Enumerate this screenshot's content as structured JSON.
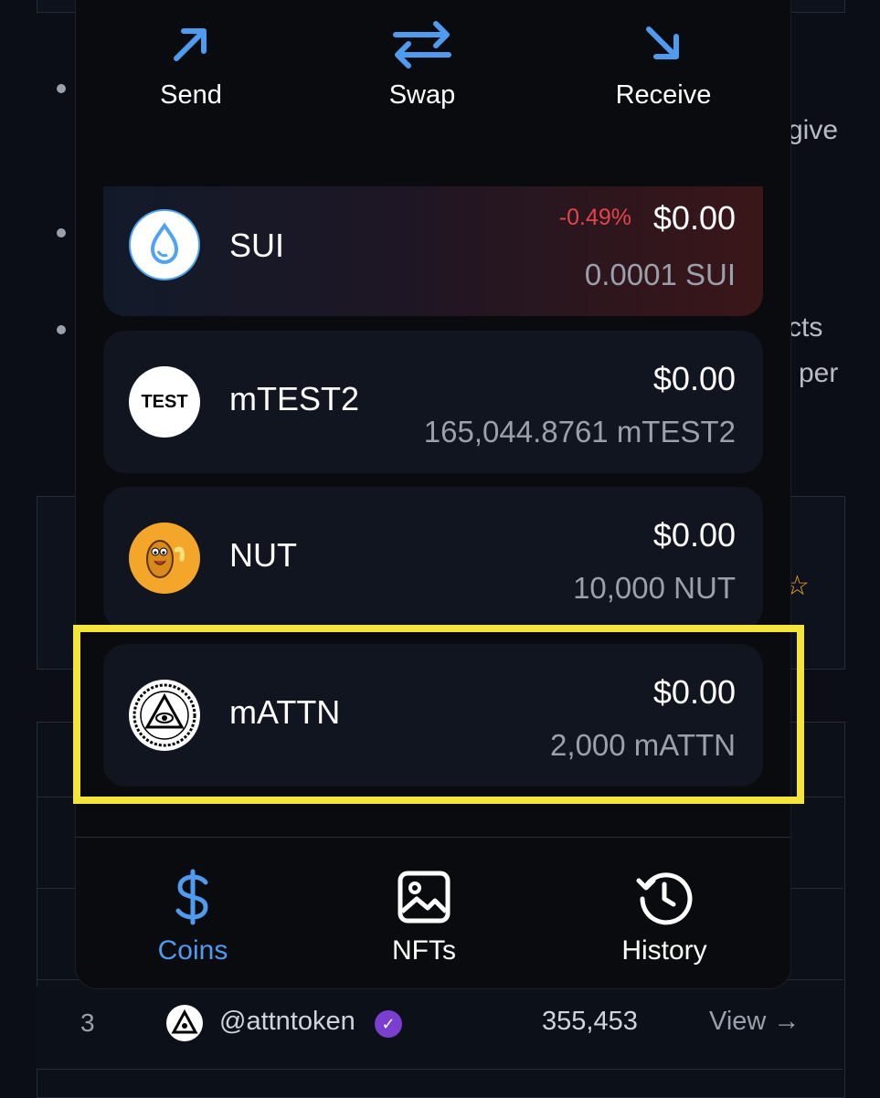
{
  "actions": [
    {
      "label": "Send",
      "icon": "arrow-up-right-icon"
    },
    {
      "label": "Swap",
      "icon": "swap-arrows-icon"
    },
    {
      "label": "Receive",
      "icon": "arrow-down-right-icon"
    }
  ],
  "coins": [
    {
      "name": "SUI",
      "change": "-0.49%",
      "usd": "$0.00",
      "amount": "0.0001 SUI"
    },
    {
      "name": "mTEST2",
      "logo_text": "TEST",
      "usd": "$0.00",
      "amount": "165,044.8761 mTEST2"
    },
    {
      "name": "NUT",
      "usd": "$0.00",
      "amount": "10,000 NUT"
    },
    {
      "name": "mATTN",
      "usd": "$0.00",
      "amount": "2,000 mATTN"
    }
  ],
  "tabs": [
    {
      "label": "Coins",
      "icon": "dollar-icon",
      "active": true
    },
    {
      "label": "NFTs",
      "icon": "image-icon",
      "active": false
    },
    {
      "label": "History",
      "icon": "history-icon",
      "active": false
    }
  ],
  "background": {
    "snippets": [
      "give",
      "cts",
      "per"
    ],
    "table_row": {
      "rank": "3",
      "handle": "@attntoken",
      "count": "355,453",
      "action": "View →"
    }
  },
  "colors": {
    "accent": "#4f9bf0",
    "negative": "#e0464b",
    "highlight": "#f5e43a"
  }
}
